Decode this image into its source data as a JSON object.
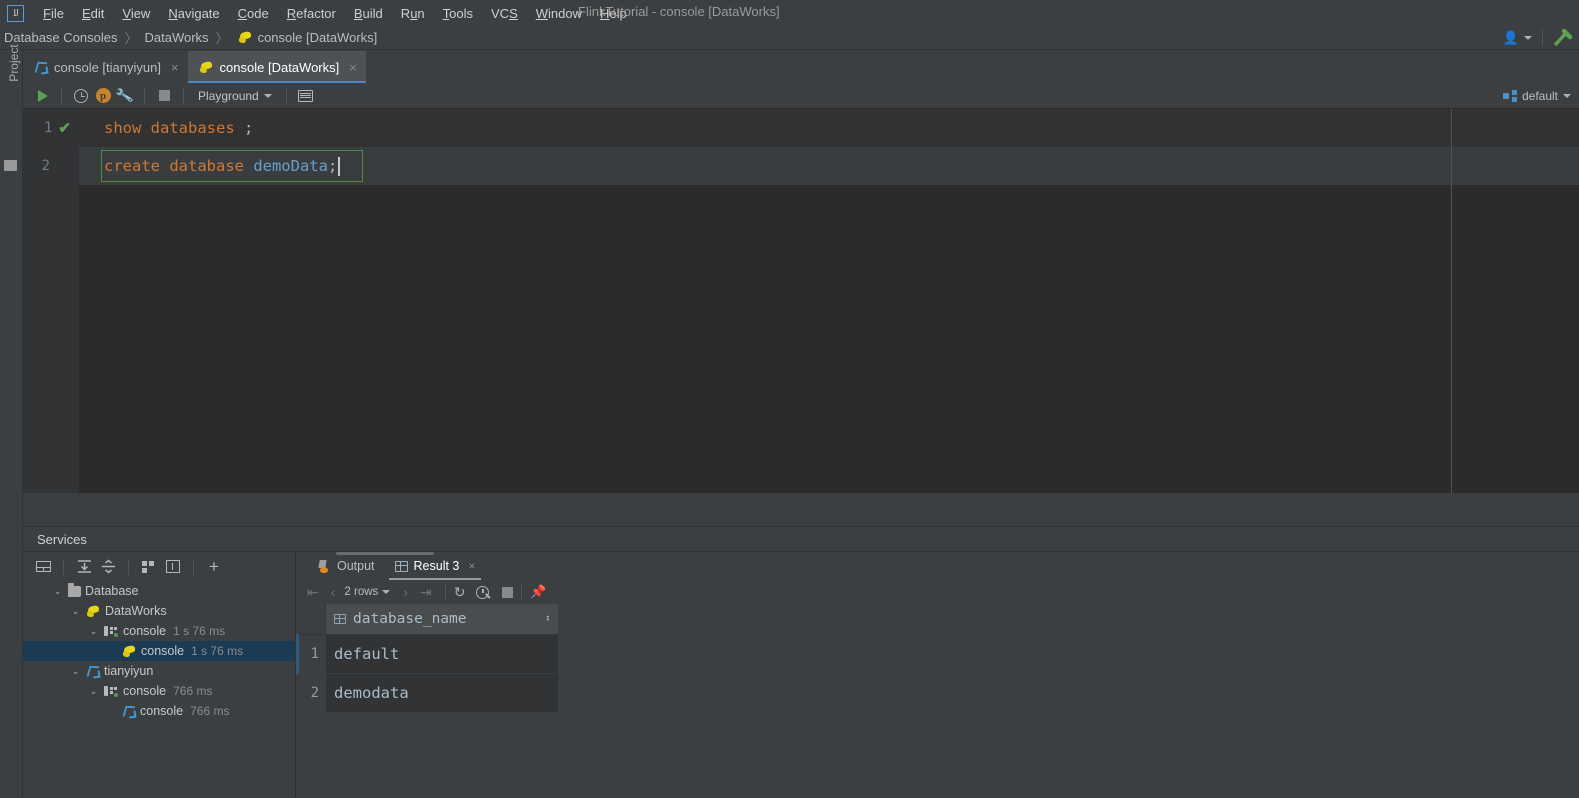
{
  "window": {
    "title": "FlinkTutorial - console [DataWorks]",
    "logo": "IJ"
  },
  "menubar": {
    "items": [
      {
        "label": "File",
        "mnemonic": "F"
      },
      {
        "label": "Edit",
        "mnemonic": "E"
      },
      {
        "label": "View",
        "mnemonic": "V"
      },
      {
        "label": "Navigate",
        "mnemonic": "N"
      },
      {
        "label": "Code",
        "mnemonic": "C"
      },
      {
        "label": "Refactor",
        "mnemonic": "R"
      },
      {
        "label": "Build",
        "mnemonic": "B"
      },
      {
        "label": "Run",
        "mnemonic": "u"
      },
      {
        "label": "Tools",
        "mnemonic": "T"
      },
      {
        "label": "VCS",
        "mnemonic": "S"
      },
      {
        "label": "Window",
        "mnemonic": "W"
      },
      {
        "label": "Help",
        "mnemonic": "H"
      }
    ]
  },
  "breadcrumb": {
    "items": [
      "Database Consoles",
      "DataWorks",
      "console [DataWorks]"
    ],
    "separator": "〉",
    "leaf_icon": "hive-icon",
    "account_icon": "user-account-icon",
    "hammer_icon": "build-hammer-icon"
  },
  "left_stripe": {
    "label": "Project",
    "icon": "project-tool-window-icon"
  },
  "editor_tabs": [
    {
      "label": "console [tianyiyun]",
      "icon": "tianyiyun-datasource-icon",
      "active": false,
      "close": "×"
    },
    {
      "label": "console [DataWorks]",
      "icon": "hive-icon",
      "active": true,
      "close": "×"
    }
  ],
  "run_toolbar": {
    "run_button": "run-icon",
    "history_button": "history-clock-icon",
    "profile_button": "p",
    "settings_button": "wrench-icon",
    "stop_button": "stop-icon",
    "session_select": "Playground",
    "session_chevron": "⌄",
    "grid_button": "data-grid-icon",
    "schema_select": "default",
    "schema_icon": "schema-cubes-icon"
  },
  "editor": {
    "lines": [
      {
        "number": "1",
        "marker": "✔",
        "tokens": [
          {
            "text": "show databases ",
            "cls": "kw"
          },
          {
            "text": ";",
            "cls": "punct"
          }
        ]
      },
      {
        "number": "2",
        "marker": "",
        "tokens": [
          {
            "text": "create database ",
            "cls": "kw"
          },
          {
            "text": "demoData",
            "cls": "ident"
          },
          {
            "text": ";",
            "cls": "punct"
          }
        ]
      }
    ],
    "line1_code": "show databases ;",
    "line2_code": "create database demoData;"
  },
  "services": {
    "title": "Services",
    "toolbar_icons": [
      "show-panel-icon",
      "expand-all-icon",
      "collapse-all-icon",
      "group-by-icon",
      "add-frame-icon",
      "add-service-icon"
    ],
    "tree": [
      {
        "label": "Database",
        "time": "",
        "icon": "folder-icon",
        "depth": 0,
        "twisty": "⌄",
        "selected": false
      },
      {
        "label": "DataWorks",
        "time": "",
        "icon": "hive-icon",
        "depth": 1,
        "twisty": "⌄",
        "selected": false
      },
      {
        "label": "console",
        "time": "1 s 76 ms",
        "icon": "console-icon",
        "depth": 2,
        "twisty": "⌄",
        "selected": false
      },
      {
        "label": "console",
        "time": "1 s 76 ms",
        "icon": "hive-icon",
        "depth": 3,
        "twisty": "",
        "selected": true
      },
      {
        "label": "tianyiyun",
        "time": "",
        "icon": "tianyiyun-datasource-icon",
        "depth": 1,
        "twisty": "⌄",
        "selected": false
      },
      {
        "label": "console",
        "time": "766 ms",
        "icon": "console-icon",
        "depth": 2,
        "twisty": "⌄",
        "selected": false
      },
      {
        "label": "console",
        "time": "766 ms",
        "icon": "tianyiyun-datasource-icon",
        "depth": 3,
        "twisty": "",
        "selected": false
      }
    ]
  },
  "results": {
    "tabs": [
      {
        "label": "Output",
        "icon": "output-icon",
        "active": false,
        "closable": false
      },
      {
        "label": "Result 3",
        "icon": "table-icon",
        "active": true,
        "closable": true,
        "close": "×"
      }
    ],
    "toolbar": {
      "first_page": "⇤",
      "prev_page": "‹",
      "rows_label": "2 rows",
      "rows_chevron": "⌄",
      "next_page": "›",
      "last_page": "⇥",
      "reload": "↻",
      "query_time": "query-time-icon",
      "cancel": "stop-icon",
      "pin": "📌"
    },
    "grid": {
      "columns": [
        "database_name"
      ],
      "column_icon": "column-icon",
      "sort_indicator": "↕",
      "rows": [
        {
          "no": "1",
          "database_name": "default"
        },
        {
          "no": "2",
          "database_name": "demodata"
        }
      ]
    }
  },
  "colors": {
    "bg_chrome": "#3c3f41",
    "bg_editor": "#2b2b2b",
    "accent_tab": "#4a88c7",
    "keyword": "#cc7832",
    "identifier": "#6a9ecb",
    "success_green": "#5aa350",
    "selection": "#1b3a54",
    "hive_yellow": "#e8d618"
  }
}
